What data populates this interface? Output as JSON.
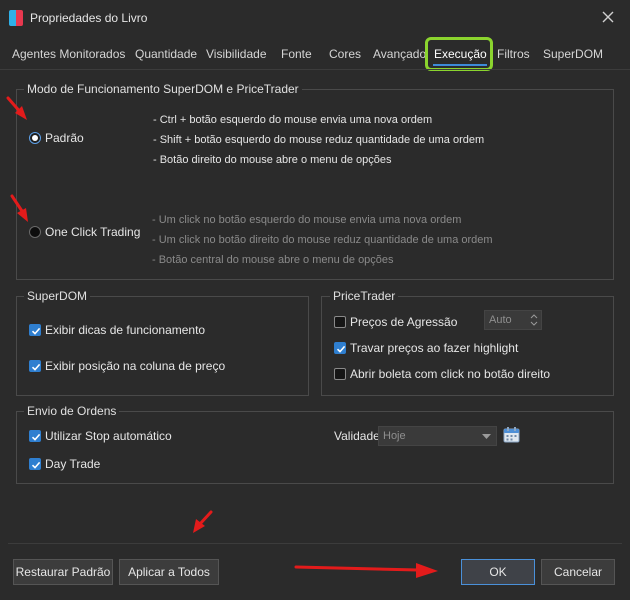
{
  "window": {
    "title": "Propriedades do Livro",
    "close_icon": "close-icon"
  },
  "tabs": [
    {
      "label": "Agentes Monitorados",
      "active": false
    },
    {
      "label": "Quantidade",
      "active": false
    },
    {
      "label": "Visibilidade",
      "active": false
    },
    {
      "label": "Fonte",
      "active": false
    },
    {
      "label": "Cores",
      "active": false
    },
    {
      "label": "Avançado",
      "active": false
    },
    {
      "label": "Execução",
      "active": true
    },
    {
      "label": "Filtros",
      "active": false
    },
    {
      "label": "SuperDOM",
      "active": false
    }
  ],
  "mode": {
    "title": "Modo de Funcionamento SuperDOM e PriceTrader",
    "standard": {
      "label": "Padrão",
      "selected": true,
      "lines": [
        "- Ctrl + botão esquerdo do mouse envia uma nova ordem",
        "- Shift + botão esquerdo do mouse reduz quantidade de uma ordem",
        "- Botão direito do mouse abre o menu de opções"
      ]
    },
    "one_click": {
      "label": "One Click Trading",
      "selected": false,
      "lines": [
        "- Um click no botão esquerdo do mouse envia uma nova ordem",
        "- Um click no botão direito do mouse reduz quantidade de uma ordem",
        "- Botão central do mouse abre o menu de opções"
      ]
    }
  },
  "superdom": {
    "title": "SuperDOM",
    "show_tips": {
      "label": "Exibir dicas de funcionamento",
      "checked": true
    },
    "show_position": {
      "label": "Exibir posição na coluna de preço",
      "checked": true
    }
  },
  "pricetrader": {
    "title": "PriceTrader",
    "aggression": {
      "label": "Preços de Agressão",
      "checked": false,
      "value": "Auto"
    },
    "lock_prices": {
      "label": "Travar preços ao fazer highlight",
      "checked": true
    },
    "open_ticket": {
      "label": "Abrir boleta com click no botão direito",
      "checked": false
    }
  },
  "orders": {
    "title": "Envio de Ordens",
    "auto_stop": {
      "label": "Utilizar Stop automático",
      "checked": true
    },
    "day_trade": {
      "label": "Day Trade",
      "checked": true
    },
    "validity": {
      "label": "Validade",
      "value": "Hoje"
    }
  },
  "buttons": {
    "restore": "Restaurar Padrão",
    "apply_all": "Aplicar a Todos",
    "ok": "OK",
    "cancel": "Cancelar"
  },
  "colors": {
    "background": "#2b2b2b",
    "accent": "#2f7fd0",
    "tab_highlight": "#8bd42e",
    "annotation_arrow": "#e31b1b"
  }
}
